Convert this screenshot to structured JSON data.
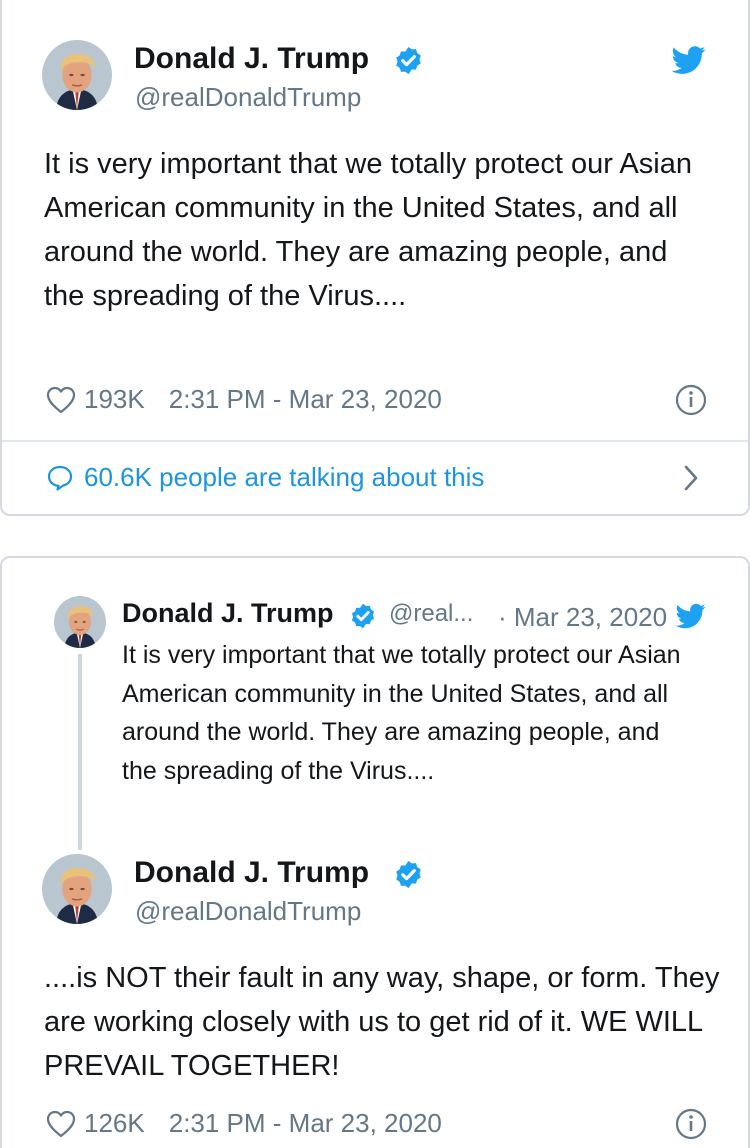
{
  "tweet1": {
    "name": "Donald J. Trump",
    "handle": "@realDonaldTrump",
    "text": "It is very important that we totally protect our Asian American community in the United States, and all around the world. They are amazing people, and the spreading of the Virus....",
    "likes": "193K",
    "timestamp": "2:31 PM - Mar 23, 2020",
    "talking": "60.6K people are talking about this"
  },
  "quoted": {
    "name": "Donald J. Trump",
    "handle_truncated": "@real...",
    "date": "· Mar 23, 2020",
    "text": "It is very important that we totally protect our Asian American community in the United States, and all around the world. They are amazing people, and the spreading of the Virus...."
  },
  "tweet2": {
    "name": "Donald J. Trump",
    "handle": "@realDonaldTrump",
    "text": "....is NOT their fault in any way, shape, or form. They are working closely with us to get rid of it. WE WILL PREVAIL TOGETHER!",
    "likes": "126K",
    "timestamp": "2:31 PM - Mar 23, 2020"
  },
  "icons": {
    "verified": "verified-badge-icon",
    "twitter": "twitter-bird-icon",
    "heart": "heart-icon",
    "info": "info-icon",
    "bubble": "speech-bubble-icon",
    "chevron": "chevron-right-icon"
  },
  "colors": {
    "twitter_blue": "#1da1f2",
    "link_blue": "#1b95e0",
    "text": "#14171a",
    "secondary": "#657786",
    "border": "#d4dadf"
  }
}
